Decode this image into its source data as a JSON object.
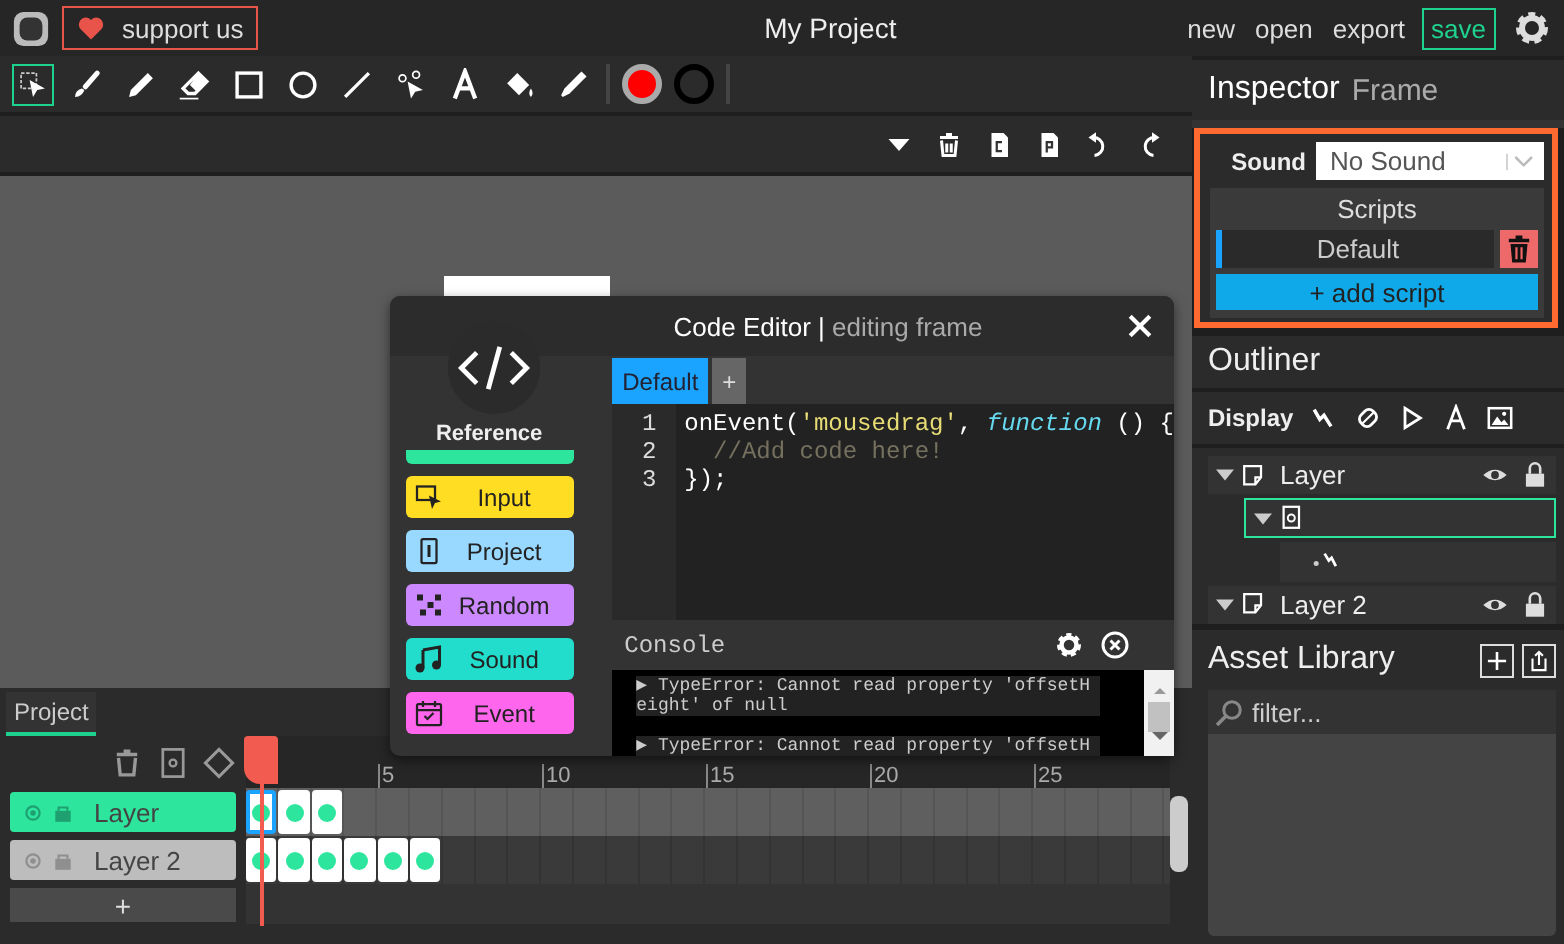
{
  "topbar": {
    "support": "support us",
    "title": "My Project",
    "menu": [
      "new",
      "open",
      "export"
    ],
    "save": "save"
  },
  "tools": [
    {
      "kind": "select",
      "selected": true
    },
    {
      "kind": "brush",
      "selected": false
    },
    {
      "kind": "pencil",
      "selected": false
    },
    {
      "kind": "eraser",
      "selected": false
    },
    {
      "kind": "rectangle",
      "selected": false
    },
    {
      "kind": "ellipse",
      "selected": false
    },
    {
      "kind": "line",
      "selected": false
    },
    {
      "kind": "pathedit",
      "selected": false
    },
    {
      "kind": "text",
      "selected": false
    },
    {
      "kind": "fill",
      "selected": false
    },
    {
      "kind": "eyedropper",
      "selected": false
    }
  ],
  "colors": [
    {
      "kind": "fill",
      "color": "#ff0000"
    },
    {
      "kind": "stroke",
      "color": "#000000"
    }
  ],
  "code_editor": {
    "title": "Code Editor |",
    "subtitle": "editing frame",
    "reference_title": "Reference",
    "reference": [
      {
        "kind": "input",
        "label": "Input",
        "color": "#ffdd22"
      },
      {
        "kind": "project",
        "label": "Project",
        "color": "#99d9ff"
      },
      {
        "kind": "random",
        "label": "Random",
        "color": "#cc88ff"
      },
      {
        "kind": "sound",
        "label": "Sound",
        "color": "#22ddcc"
      },
      {
        "kind": "event",
        "label": "Event",
        "color": "#ff66ee"
      }
    ],
    "tabs": [
      {
        "label": "Default",
        "selected": true
      },
      {
        "label": "+",
        "selected": false
      }
    ],
    "code": [
      {
        "number": "1",
        "tokens": [
          {
            "kind": "plain",
            "text": "onEvent("
          },
          {
            "kind": "string",
            "text": "'mousedrag'"
          },
          {
            "kind": "plain",
            "text": ", "
          },
          {
            "kind": "keyword",
            "text": "function"
          },
          {
            "kind": "plain",
            "text": " () {"
          }
        ]
      },
      {
        "number": "2",
        "tokens": [
          {
            "kind": "comment",
            "text": "  //Add code here!"
          }
        ]
      },
      {
        "number": "3",
        "tokens": [
          {
            "kind": "plain",
            "text": "});"
          }
        ]
      }
    ],
    "console": {
      "title": "Console",
      "messages": [
        "▶ TypeError: Cannot read property 'offsetHeight' of null",
        "▶ TypeError: Cannot read property 'offsetH"
      ]
    }
  },
  "timeline": {
    "tab": "Project",
    "ruler": [
      "5",
      "10",
      "15",
      "20",
      "25"
    ],
    "layers": [
      {
        "name": "Layer",
        "selected": true,
        "frames": [
          {
            "selected": true
          },
          {
            "selected": false
          },
          {
            "selected": false
          }
        ]
      },
      {
        "name": "Layer 2",
        "selected": false,
        "frames": [
          {
            "selected": false
          },
          {
            "selected": false
          },
          {
            "selected": false
          },
          {
            "selected": false
          },
          {
            "selected": false
          },
          {
            "selected": false
          }
        ]
      }
    ],
    "add_layer": "+"
  },
  "inspector": {
    "title": "Inspector",
    "subtitle": "Frame",
    "sound_label": "Sound",
    "sound_value": "No Sound",
    "scripts_title": "Scripts",
    "scripts": [
      {
        "name": "Default",
        "selected": true
      }
    ],
    "add_script": "+ add script"
  },
  "outliner": {
    "title": "Outliner",
    "display_label": "Display",
    "tree": [
      {
        "kind": "layer",
        "label": "Layer",
        "expanded": true,
        "selected": false,
        "children": [
          {
            "kind": "frame",
            "expanded": true,
            "selected": true,
            "children": [
              {
                "kind": "path",
                "expanded": false,
                "selected": false
              }
            ]
          }
        ]
      },
      {
        "kind": "layer",
        "label": "Layer 2",
        "expanded": true,
        "selected": false
      }
    ]
  },
  "assets": {
    "title": "Asset Library",
    "placeholder": "filter..."
  }
}
